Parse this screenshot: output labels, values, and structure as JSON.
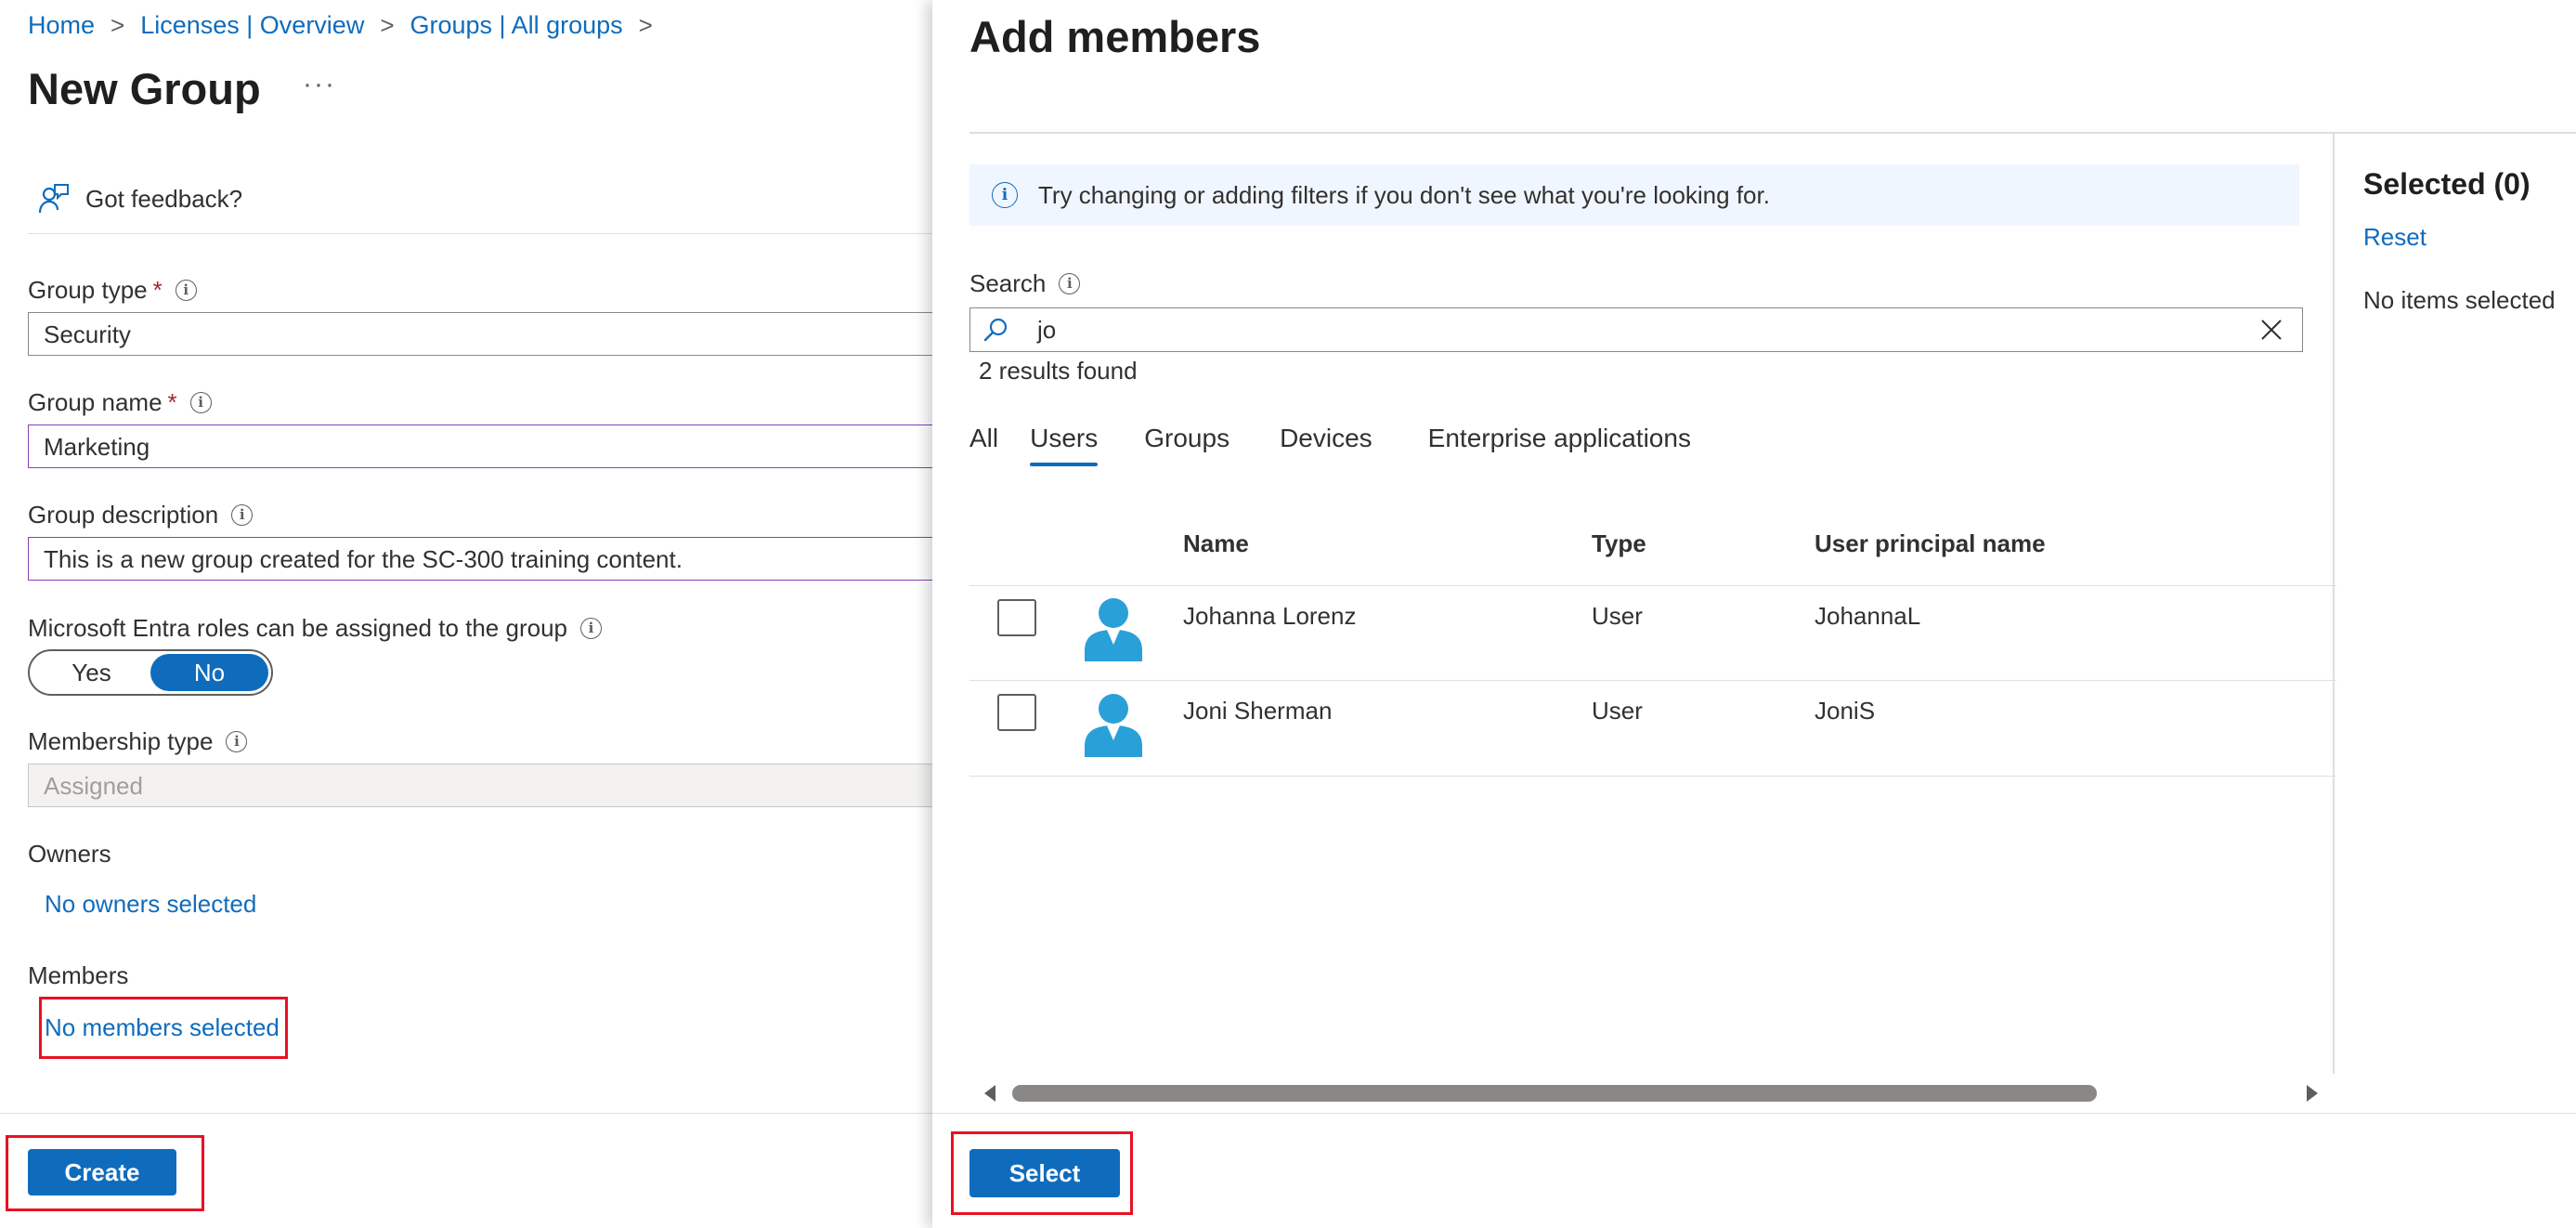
{
  "breadcrumb": {
    "items": [
      "Home",
      "Licenses | Overview",
      "Groups | All groups"
    ],
    "separator": ">"
  },
  "page": {
    "title": "New Group",
    "more": "···"
  },
  "feedback": {
    "label": "Got feedback?"
  },
  "form": {
    "group_type": {
      "label": "Group type",
      "required": "*",
      "value": "Security"
    },
    "group_name": {
      "label": "Group name",
      "required": "*",
      "value": "Marketing"
    },
    "group_description": {
      "label": "Group description",
      "value": "This is a new group created for the SC-300 training content."
    },
    "entra_roles": {
      "label": "Microsoft Entra roles can be assigned to the group",
      "yes": "Yes",
      "no": "No",
      "selected": "No"
    },
    "membership_type": {
      "label": "Membership type",
      "value": "Assigned"
    },
    "owners": {
      "label": "Owners",
      "link": "No owners selected"
    },
    "members": {
      "label": "Members",
      "link": "No members selected"
    }
  },
  "left_footer": {
    "create_label": "Create"
  },
  "panel": {
    "title": "Add members",
    "info_message": "Try changing or adding filters if you don't see what you're looking for.",
    "search": {
      "label": "Search",
      "value": "jo"
    },
    "results_text": "2 results found",
    "tabs": [
      {
        "label": "All",
        "active": false
      },
      {
        "label": "Users",
        "active": true
      },
      {
        "label": "Groups",
        "active": false
      },
      {
        "label": "Devices",
        "active": false
      },
      {
        "label": "Enterprise applications",
        "active": false
      }
    ],
    "columns": {
      "name": "Name",
      "type": "Type",
      "upn": "User principal name"
    },
    "rows": [
      {
        "name": "Johanna Lorenz",
        "type": "User",
        "upn": "JohannaL"
      },
      {
        "name": "Joni Sherman",
        "type": "User",
        "upn": "JoniS"
      }
    ],
    "selected": {
      "title": "Selected (0)",
      "reset": "Reset",
      "empty": "No items selected"
    },
    "select_label": "Select"
  },
  "colors": {
    "accent": "#0f6cbd",
    "highlight_box": "#e81123",
    "required": "#a4262c",
    "focus_border": "#8a3fb5"
  }
}
